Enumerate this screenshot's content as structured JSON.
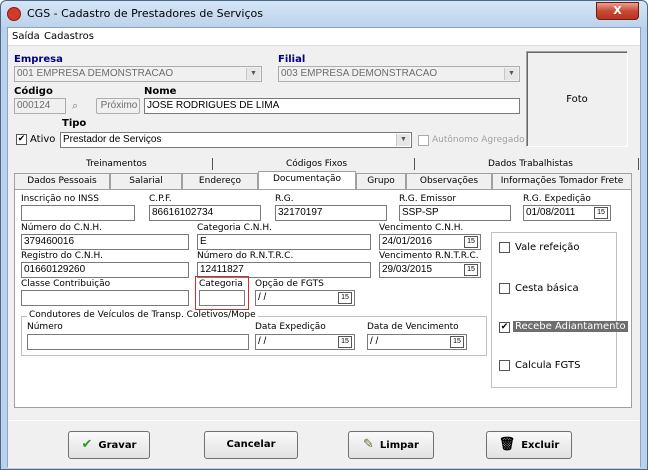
{
  "window": {
    "title": "CGS - Cadastro de Prestadores de Serviços",
    "close_glyph": "X"
  },
  "menu": {
    "items": [
      {
        "label": "Saída"
      },
      {
        "label": "Cadastros"
      }
    ]
  },
  "header": {
    "empresa_label": "Empresa",
    "empresa_value": "001 EMPRESA DEMONSTRACAO",
    "filial_label": "Filial",
    "filial_value": "003 EMPRESA DEMONSTRACAO",
    "codigo_label": "Código",
    "codigo_value": "000124",
    "proximo_label": "Próximo",
    "nome_label": "Nome",
    "nome_value": "JOSE RODRIGUES  DE LIMA",
    "tipo_label": "Tipo",
    "ativo_label": "Ativo",
    "ativo_checked": "✔",
    "tipo_value": "Prestador de Serviços",
    "autonomo_label": "Autônomo Agregado",
    "foto_label": "Foto"
  },
  "tabs_row1": [
    "Treinamentos",
    "Códigos Fixos",
    "Dados Trabalhistas"
  ],
  "tabs_row2": [
    "Dados Pessoais",
    "Salarial",
    "Endereço",
    "Documentação",
    "Grupo",
    "Observações",
    "Informações Tomador Frete"
  ],
  "doc": {
    "inss_label": "Inscrição no INSS",
    "inss_value": "",
    "cpf_label": "C.P.F.",
    "cpf_value": "86616102734",
    "rg_label": "R.G.",
    "rg_value": "32170197",
    "rg_emissor_label": "R.G. Emissor",
    "rg_emissor_value": "SSP-SP",
    "rg_exped_label": "R.G. Expedição",
    "rg_exped_value": "01/08/2011",
    "cnh_label": "Número do C.N.H.",
    "cnh_value": "379460016",
    "cat_cnh_label": "Categoria C.N.H.",
    "cat_cnh_value": "E",
    "venc_cnh_label": "Vencimento C.N.H.",
    "venc_cnh_value": "24/01/2016",
    "reg_cnh_label": "Registro do C.N.H.",
    "reg_cnh_value": "01660129260",
    "rntrc_label": "Número do R.N.T.R.C.",
    "rntrc_value": "12411827",
    "venc_rntrc_label": "Vencimento R.N.T.R.C.",
    "venc_rntrc_value": "29/03/2015",
    "classe_label": "Classe Contribuição",
    "classe_value": "",
    "categoria_label": "Categoria",
    "categoria_value": "",
    "fgts_label": "Opção de FGTS",
    "fgts_value": " / /",
    "condutores_label": "Condutores de Veículos de Transp. Coletivos/Mope",
    "numero_label": "Número",
    "numero_value": "",
    "data_exped_label": "Data Expedição",
    "data_exped_value": " / /",
    "data_venc_label": "Data de Vencimento",
    "data_venc_value": " / /",
    "cal_glyph": "15"
  },
  "options": [
    {
      "label": "Vale refeição",
      "checked": ""
    },
    {
      "label": "Cesta básica",
      "checked": ""
    },
    {
      "label": "Recebe Adiantamento",
      "checked": "✔"
    },
    {
      "label": "Calcula FGTS",
      "checked": ""
    }
  ],
  "buttons": {
    "gravar": "Gravar",
    "cancelar": "Cancelar",
    "limpar": "Limpar",
    "excluir": "Excluir"
  }
}
